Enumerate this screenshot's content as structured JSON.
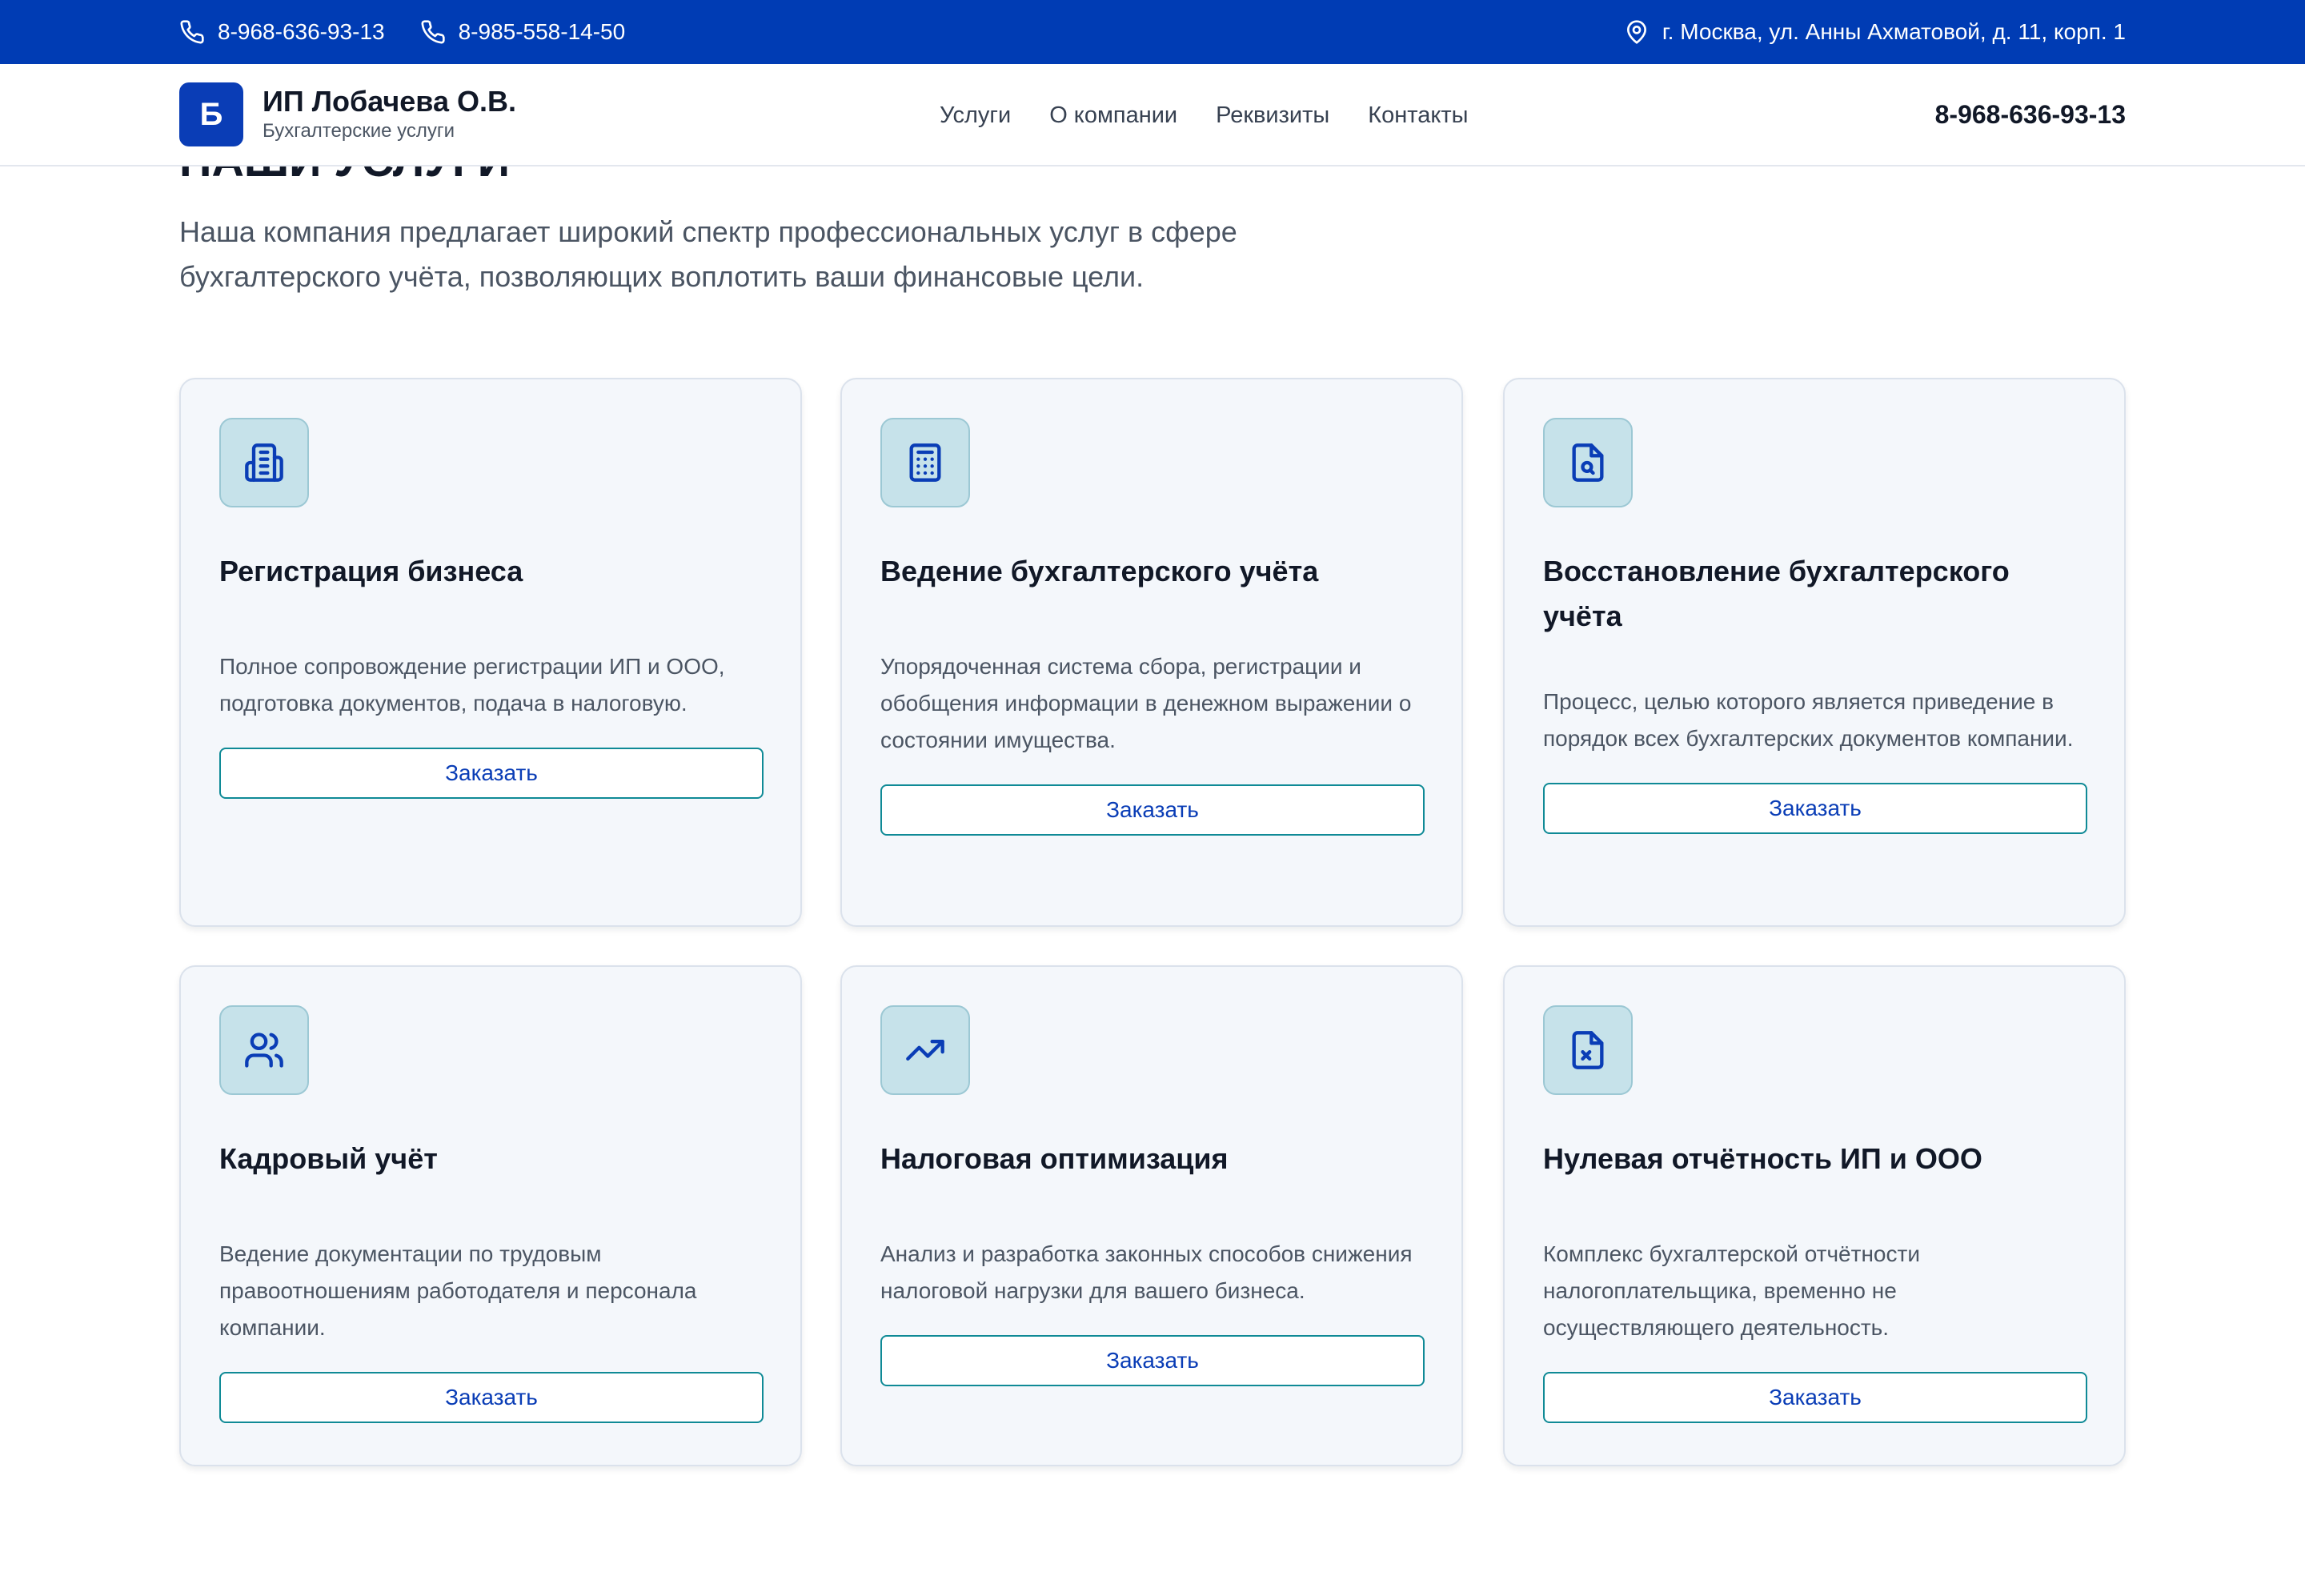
{
  "topbar": {
    "phone1": "8-968-636-93-13",
    "phone2": "8-985-558-14-50",
    "address": "г. Москва, ул. Анны Ахматовой, д. 11, корп. 1"
  },
  "header": {
    "logo_letter": "Б",
    "brand_name": "ИП Лобачева О.В.",
    "brand_sub": "Бухгалтерские услуги",
    "nav": [
      "Услуги",
      "О компании",
      "Реквизиты",
      "Контакты"
    ],
    "phone": "8-968-636-93-13"
  },
  "section": {
    "title": "НАШИ УСЛУГИ",
    "intro": "Наша компания предлагает широкий спектр профессиональных услуг в сфере бухгалтерского учёта, позволяющих воплотить ваши финансовые цели."
  },
  "cards": [
    {
      "icon": "building-icon",
      "title": "Регистрация бизнеса",
      "desc": "Полное сопровождение регистрации ИП и ООО, подготовка документов, подача в налоговую.",
      "button": "Заказать"
    },
    {
      "icon": "calculator-icon",
      "title": "Ведение бухгалтерского учёта",
      "desc": "Упорядоченная система сбора, регистрации и обобщения информации в денежном выражении о состоянии имущества.",
      "button": "Заказать"
    },
    {
      "icon": "file-search-icon",
      "title": "Восстановление бухгалтерского учёта",
      "desc": "Процесс, целью которого является приведение в порядок всех бухгалтерских документов компании.",
      "button": "Заказать"
    },
    {
      "icon": "users-icon",
      "title": "Кадровый учёт",
      "desc": "Ведение документации по трудовым правоотношениям работодателя и персонала компании.",
      "button": "Заказать"
    },
    {
      "icon": "trending-up-icon",
      "title": "Налоговая оптимизация",
      "desc": "Анализ и разработка законных способов снижения налоговой нагрузки для вашего бизнеса.",
      "button": "Заказать"
    },
    {
      "icon": "file-x-icon",
      "title": "Нулевая отчётность ИП и ООО",
      "desc": "Комплекс бухгалтерской отчётности налогоплательщика, временно не осуществляющего деятельность.",
      "button": "Заказать"
    }
  ],
  "colors": {
    "topbar_bg": "#003cb4",
    "accent": "#0a3db6",
    "button_border": "#0f8a96",
    "card_bg": "#f4f7fb",
    "icon_bg": "#c6e2ea"
  }
}
